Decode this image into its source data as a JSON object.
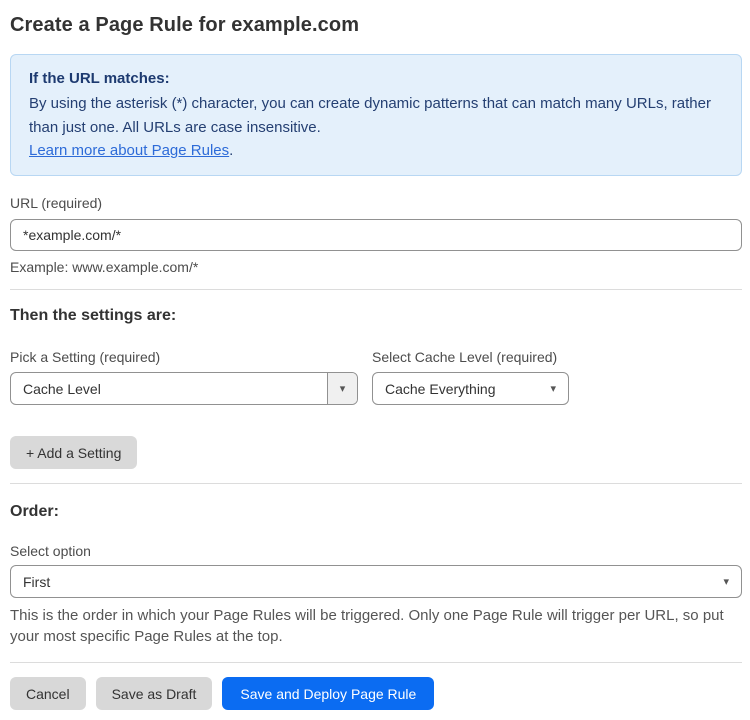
{
  "page": {
    "title": "Create a Page Rule for example.com"
  },
  "info_box": {
    "heading": "If the URL matches:",
    "body": "By using the asterisk (*) character, you can create dynamic patterns that can match many URLs, rather than just one. All URLs are case insensitive.",
    "link_label": "Learn more about Page Rules",
    "link_suffix": "."
  },
  "url_field": {
    "label": "URL (required)",
    "value": "*example.com/*",
    "example": "Example: www.example.com/*"
  },
  "settings": {
    "heading": "Then the settings are:",
    "setting_picker": {
      "label": "Pick a Setting (required)",
      "selected": "Cache Level"
    },
    "cache_level_picker": {
      "label": "Select Cache Level (required)",
      "selected": "Cache Everything"
    },
    "add_setting_label": "+ Add a Setting"
  },
  "order": {
    "heading": "Order:",
    "select_label": "Select option",
    "selected": "First",
    "help": "This is the order in which your Page Rules will be triggered. Only one Page Rule will trigger per URL, so put your most specific Page Rules at the top."
  },
  "footer": {
    "cancel_label": "Cancel",
    "save_draft_label": "Save as Draft",
    "save_deploy_label": "Save and Deploy Page Rule"
  },
  "icons": {
    "caret_glyph": "▾"
  },
  "colors": {
    "accent_blue": "#0b6cf2",
    "info_bg": "#e4f0fb",
    "info_border": "#b8d7f3",
    "info_text": "#243f72",
    "link_blue": "#2d6bd8",
    "button_gray": "#d8d8d8"
  }
}
